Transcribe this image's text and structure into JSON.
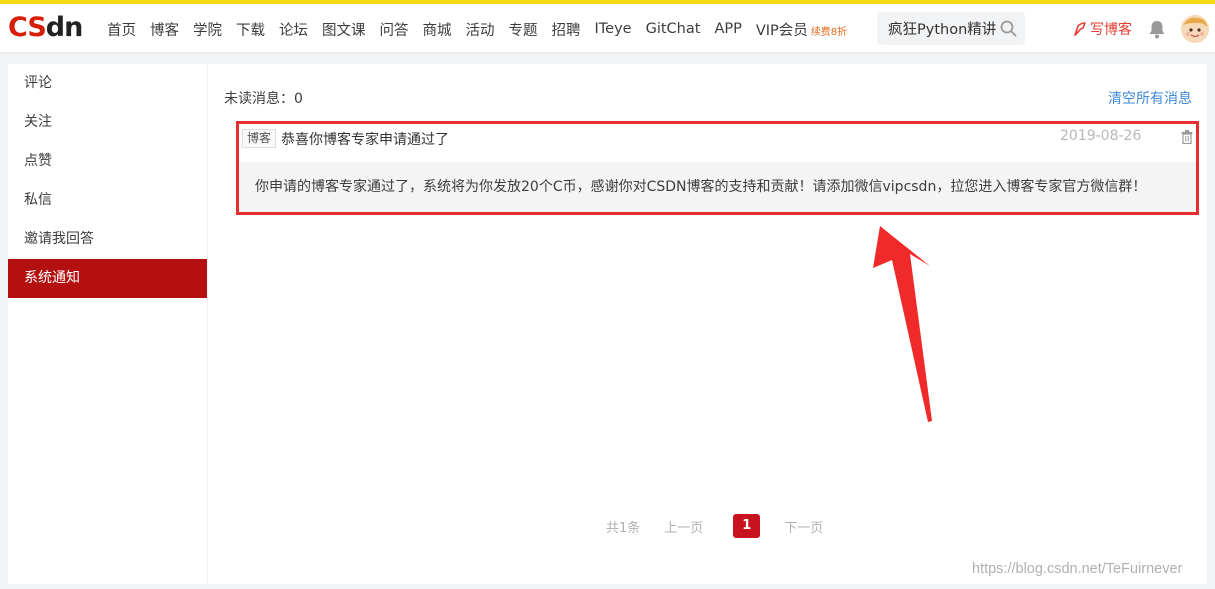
{
  "brand": {
    "logo_text": "CSDN",
    "accent": "#d81e06"
  },
  "nav": {
    "items": [
      "首页",
      "博客",
      "学院",
      "下载",
      "论坛",
      "图文课",
      "问答",
      "商城",
      "活动",
      "专题",
      "招聘",
      "ITeye",
      "GitChat",
      "APP",
      "VIP会员"
    ],
    "vip_badge": "续费8折"
  },
  "search": {
    "value": "疯狂Python精讲"
  },
  "header": {
    "write_blog": "写博客"
  },
  "sidebar": {
    "items": [
      "评论",
      "关注",
      "点赞",
      "私信",
      "邀请我回答",
      "系统通知"
    ],
    "active": "系统通知",
    "active_color": "#b3100f"
  },
  "main": {
    "unread_label": "未读消息：0",
    "clear_all": "清空所有消息",
    "messages": [
      {
        "tag": "博客",
        "title": "恭喜你博客专家申请通过了",
        "date": "2019-08-26",
        "body": "你申请的博客专家通过了，系统将为你发放20个C币，感谢你对CSDN博客的支持和贡献！请添加微信vipcsdn，拉您进入博客专家官方微信群！"
      }
    ]
  },
  "pagination": {
    "total": "共1条",
    "prev": "上一页",
    "current": "1",
    "next": "下一页"
  },
  "annotation": {
    "highlight_color": "#e52e2e"
  },
  "watermark": "https://blog.csdn.net/TeFuirnever"
}
